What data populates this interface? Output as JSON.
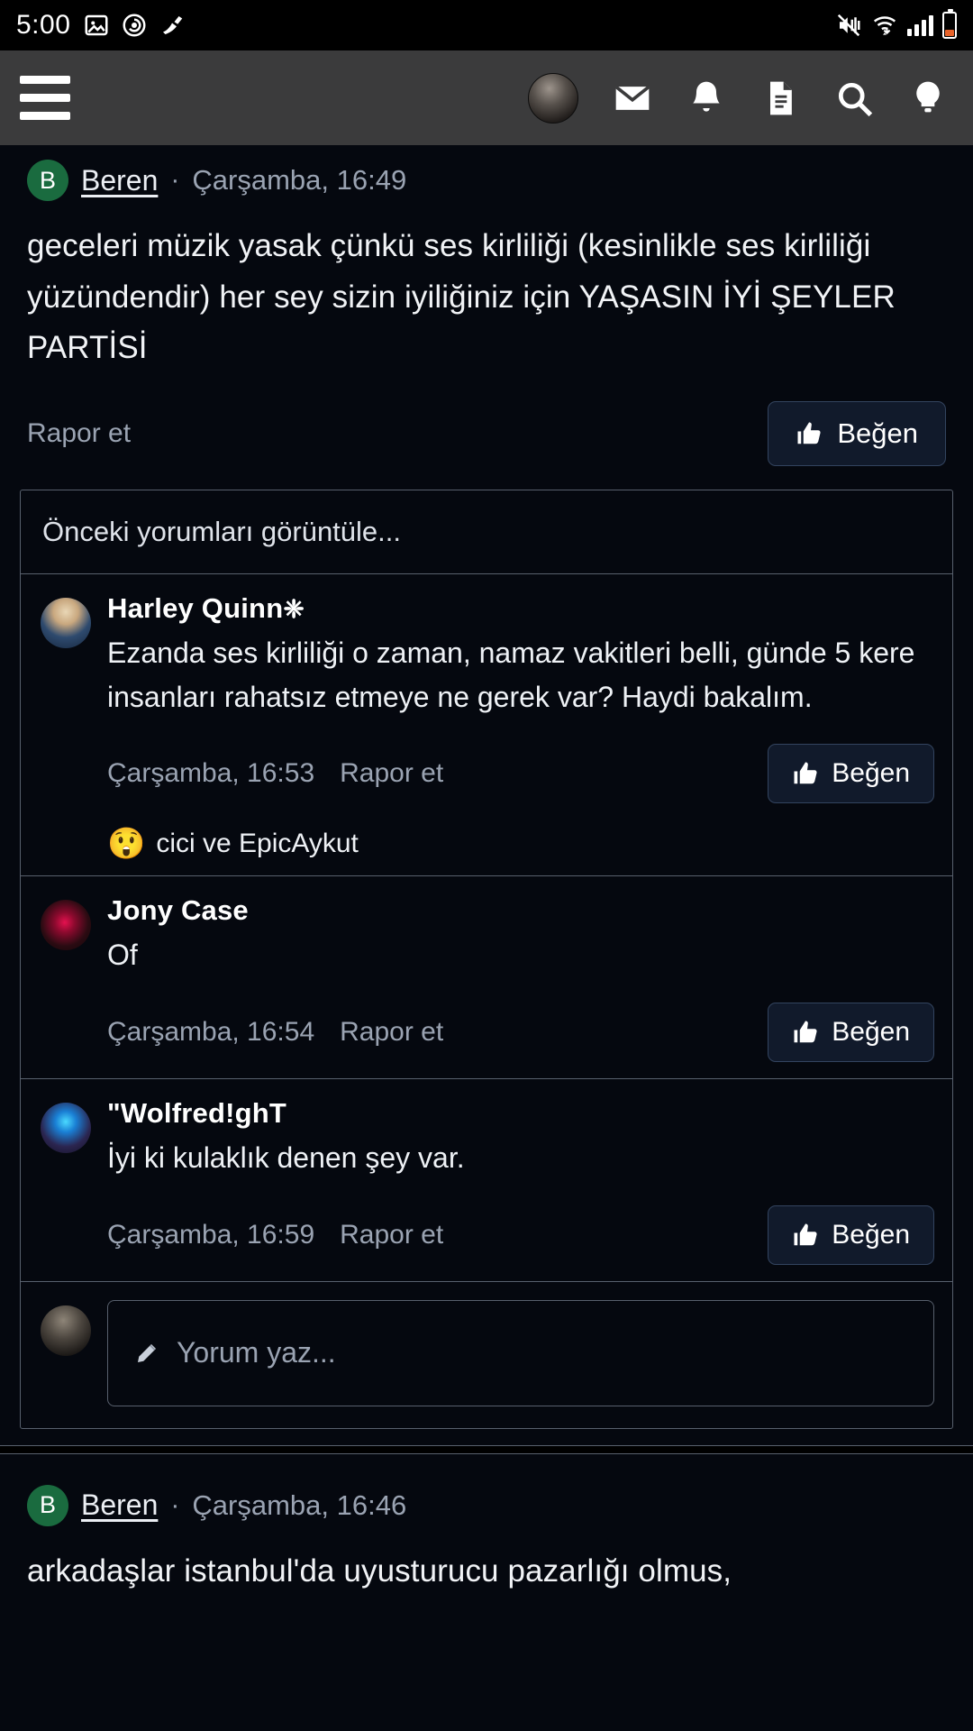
{
  "statusbar": {
    "clock": "5:00",
    "icons_left": [
      "image-icon",
      "screen-record-icon",
      "cleaner-icon"
    ],
    "icons_right": [
      "mute-vibrate-icon",
      "wifi-icon",
      "signal-icon",
      "battery-icon"
    ]
  },
  "toolbar": {
    "menu_icon": "hamburger-menu-icon",
    "avatar": "user-avatar",
    "icons": [
      "mail-icon",
      "bell-icon",
      "document-icon",
      "search-icon",
      "bulb-icon"
    ]
  },
  "post": {
    "avatar_letter": "B",
    "author": "Beren",
    "separator": "·",
    "time": "Çarşamba, 16:49",
    "body": "geceleri müzik yasak çünkü ses kirliliği (kesinlikle ses kirliliği yüzündendir) her sey sizin iyiliğiniz için YAŞASIN İYİ ŞEYLER PARTİSİ",
    "report_label": "Rapor et",
    "like_label": "Beğen"
  },
  "comments_section": {
    "previous_label": "Önceki yorumları görüntüle...",
    "items": [
      {
        "avatar": "harley-quinn-avatar",
        "name": "Harley Quinn",
        "verified_glyph": "❈",
        "text": "Ezanda ses kirliliği o zaman, namaz vakitleri belli, günde 5 kere insanları rahatsız etmeye ne gerek var? Haydi bakalım.",
        "time": "Çarşamba, 16:53",
        "report_label": "Rapor et",
        "like_label": "Beğen",
        "reaction_emoji": "😲",
        "reaction_text": "cici ve EpicAykut"
      },
      {
        "avatar": "jony-case-avatar",
        "name": "Jony Case",
        "verified_glyph": "",
        "text": "Of",
        "time": "Çarşamba, 16:54",
        "report_label": "Rapor et",
        "like_label": "Beğen",
        "reaction_emoji": "",
        "reaction_text": ""
      },
      {
        "avatar": "wolfred-avatar",
        "name": "\"Wolfred!ghT",
        "verified_glyph": "",
        "text": "İyi ki kulaklık denen şey var.",
        "time": "Çarşamba, 16:59",
        "report_label": "Rapor et",
        "like_label": "Beğen",
        "reaction_emoji": "",
        "reaction_text": ""
      }
    ],
    "composer": {
      "avatar": "current-user-avatar",
      "pencil_icon": "pencil-icon",
      "placeholder": "Yorum yaz..."
    }
  },
  "post2": {
    "avatar_letter": "B",
    "author": "Beren",
    "separator": "·",
    "time": "Çarşamba, 16:46",
    "body": "arkadaşlar istanbul'da uyusturucu pazarlığı olmus,"
  },
  "colors": {
    "page_bg": "#05080f",
    "toolbar_bg": "#3b3b3c",
    "statusbar_bg": "#000000",
    "accent_green": "#1a6b3f",
    "like_bg": "#111a2b",
    "like_border": "#33445f",
    "muted_text": "#9aa3b2",
    "border": "#58606d",
    "battery_fill": "#e8632a"
  }
}
